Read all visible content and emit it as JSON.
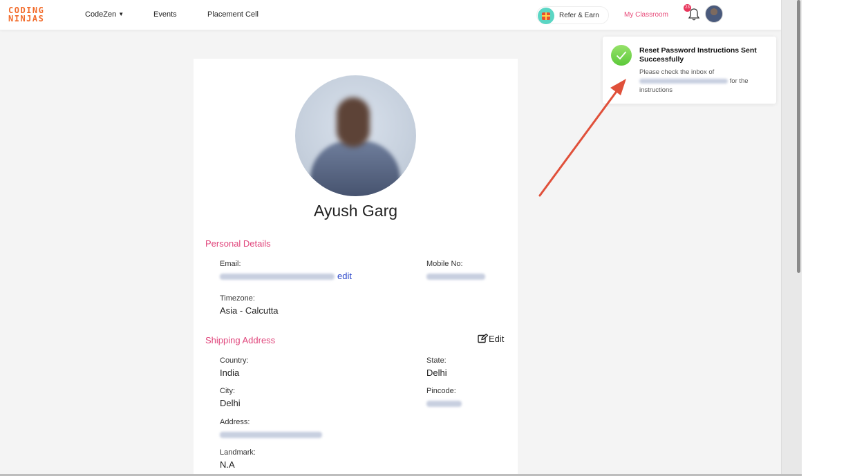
{
  "header": {
    "logo_line1": "CODING",
    "logo_line2": "NINJAS",
    "nav": {
      "codezen": "CodeZen",
      "events": "Events",
      "placement": "Placement Cell"
    },
    "refer": "Refer & Earn",
    "classroom": "My Classroom",
    "notification_count": "23"
  },
  "profile": {
    "name": "Ayush Garg"
  },
  "personal": {
    "title": "Personal Details",
    "email_label": "Email:",
    "edit_link": "edit",
    "mobile_label": "Mobile No:",
    "timezone_label": "Timezone:",
    "timezone_value": "Asia - Calcutta"
  },
  "shipping": {
    "title": "Shipping Address",
    "edit": "Edit",
    "country_label": "Country:",
    "country_value": "India",
    "state_label": "State:",
    "state_value": "Delhi",
    "city_label": "City:",
    "city_value": "Delhi",
    "pincode_label": "Pincode:",
    "address_label": "Address:",
    "landmark_label": "Landmark:",
    "landmark_value": "N.A"
  },
  "toast": {
    "title": "Reset Password Instructions Sent Successfully",
    "msg_prefix": "Please check the inbox of",
    "msg_suffix": "for the instructions"
  },
  "colors": {
    "accent_pink": "#e0457b",
    "link_blue": "#2a46c9",
    "arrow_red": "#e0503a",
    "success_green": "#6ccf45"
  }
}
